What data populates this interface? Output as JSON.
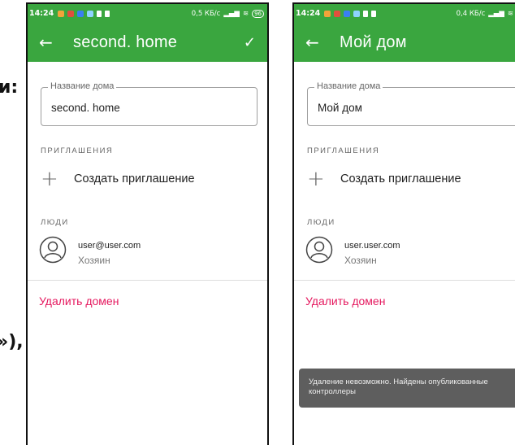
{
  "cropped": {
    "text1": "и:",
    "text2": "»),"
  },
  "phone1": {
    "status": {
      "time": "14:24",
      "net": "0,5 КБ/с",
      "battery": "96"
    },
    "appbar": {
      "title": "second. home"
    },
    "field": {
      "label": "Название дома",
      "value": "second. home"
    },
    "invitations": {
      "header": "ПРИГЛАШЕНИЯ",
      "create_label": "Создать приглашение"
    },
    "people": {
      "header": "ЛЮДИ",
      "email": "user@user.com",
      "role": "Хозяин"
    },
    "delete_label": "Удалить домен"
  },
  "phone2": {
    "status": {
      "time": "14:24",
      "net": "0,4 КБ/с"
    },
    "appbar": {
      "title": "Мой дом"
    },
    "field": {
      "label": "Название дома",
      "value": "Мой дом"
    },
    "invitations": {
      "header": "ПРИГЛАШЕНИЯ",
      "create_label": "Создать приглашение"
    },
    "people": {
      "header": "ЛЮДИ",
      "email": "user.user.com",
      "role": "Хозяин"
    },
    "delete_label": "Удалить домен",
    "snackbar": "Удаление невозможно. Найдены опубликованные контроллеры"
  },
  "colors": {
    "primary": "#3aa63f",
    "delete": "#e5195f",
    "snackbar": "#5e5e5e"
  },
  "icons": {
    "back": "arrow-left-icon",
    "check": "check-icon",
    "add": "plus-icon",
    "avatar": "person-circle-icon"
  }
}
